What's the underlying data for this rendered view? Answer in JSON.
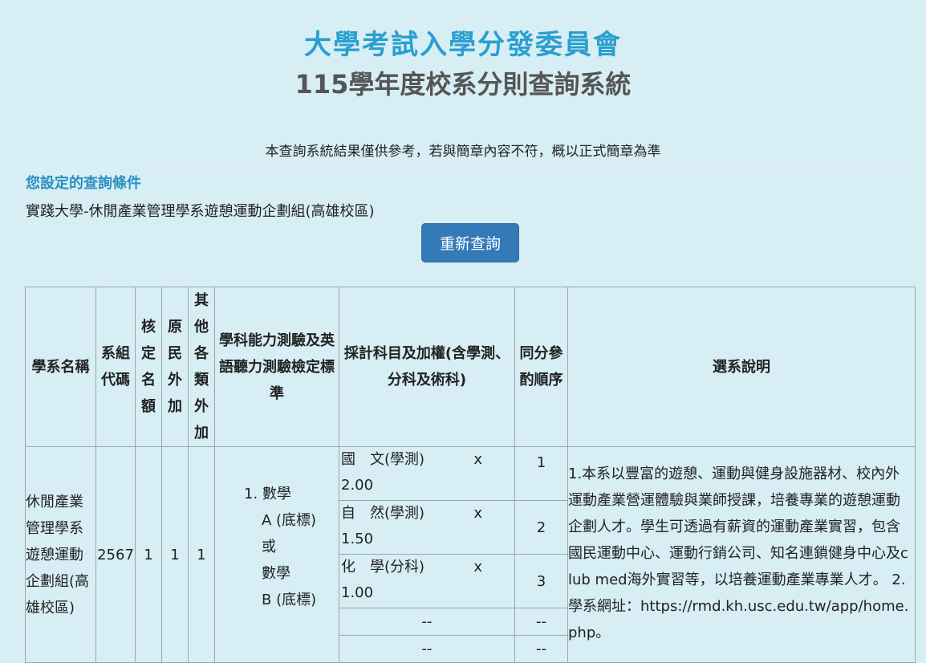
{
  "header": {
    "org_title": "大學考試入學分發委員會",
    "system_title": "115學年度校系分則查詢系統"
  },
  "disclaimer": "本查詢系統結果僅供參考，若與簡章內容不符，概以正式簡章為準",
  "query": {
    "label": "您設定的查詢條件",
    "value": "實踐大學-休閒產業管理學系遊憩運動企劃組(高雄校區)",
    "requery_button": "重新查詢"
  },
  "table": {
    "headers": {
      "dept_name": "學系名稱",
      "dept_code": "系組代碼",
      "quota": "核定名額",
      "indigenous": "原民外加",
      "other_extra": "其他各類外加",
      "standard": "學科能力測驗及英語聽力測驗檢定標準",
      "subjects": "採計科目及加權(含學測、分科及術科)",
      "tie_order": "同分參酌順序",
      "description": "選系說明"
    },
    "row": {
      "dept_name": "休閒產業管理學系遊憩運動企劃組(高雄校區)",
      "dept_code": "2567",
      "quota": "1",
      "indigenous": "1",
      "other_extra": "1",
      "standard": [
        "1. 數學",
        "A (底標)",
        "或",
        "數學",
        "B (底標)"
      ],
      "subjects": [
        {
          "name": "國　文(學測)",
          "x": "x",
          "weight": "2.00",
          "order": "1"
        },
        {
          "name": "自　然(學測)",
          "x": "x",
          "weight": "1.50",
          "order": "2"
        },
        {
          "name": "化　學(分科)",
          "x": "x",
          "weight": "1.00",
          "order": "3"
        },
        {
          "name": "--",
          "order": "--"
        },
        {
          "name": "--",
          "order": "--"
        }
      ],
      "description": "1.本系以豐富的遊憩、運動與健身設施器材、校內外運動產業營運體驗與業師授課，培養專業的遊憩運動企劃人才。學生可透過有薪資的運動產業實習，包含國民運動中心、運動行銷公司、知名連鎖健身中心及club med海外實習等，以培養運動產業專業人才。 2.學系網址：https://rmd.kh.usc.edu.tw/app/home.php。"
    }
  }
}
